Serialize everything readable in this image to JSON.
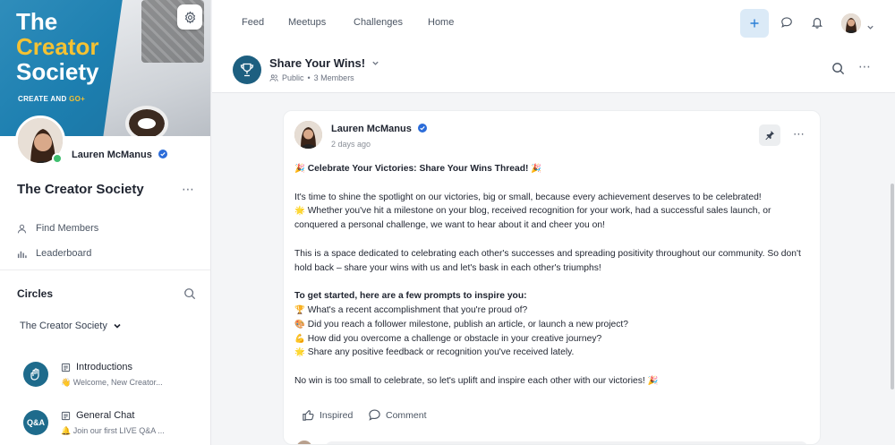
{
  "sidebar": {
    "banner": {
      "title_line1": "The",
      "title_line2": "Creator",
      "title_line3": "Society",
      "tagline_part1": "CREATE AND ",
      "tagline_part2": "GO+"
    },
    "profile_name": "Lauren McManus",
    "community_name": "The Creator Society",
    "more_glyph": "⋯",
    "links": [
      {
        "label": "Find Members",
        "icon": "person-icon"
      },
      {
        "label": "Leaderboard",
        "icon": "bar-chart-icon"
      }
    ],
    "circles_title": "Circles",
    "circle_dropdown": "The Creator Society",
    "spaces": [
      {
        "title": "Introductions",
        "subtitle": "👋 Welcome, New Creator...",
        "icon": "wave-hand-icon"
      },
      {
        "title": "General Chat",
        "subtitle": "🔔 Join our first LIVE Q&A ...",
        "icon_text": "Q&A"
      }
    ]
  },
  "topnav": {
    "links": [
      "Feed",
      "Meetups",
      "Challenges",
      "Home"
    ],
    "icons": [
      "plus-icon",
      "chat-bubble-icon",
      "bell-icon",
      "avatar",
      "chevron-down-icon"
    ]
  },
  "space_header": {
    "title": "Share Your Wins!",
    "visibility": "Public",
    "separator": "•",
    "members": "3 Members",
    "more_glyph": "⋯"
  },
  "post": {
    "author": "Lauren McManus",
    "time": "2 days ago",
    "more_glyph": "⋯",
    "heading_emoji": "🎉",
    "heading": "Celebrate Your Victories: Share Your Wins Thread!",
    "para1": "It's time to shine the spotlight on our victories, big or small, because every achievement deserves to be celebrated!",
    "para1_emoji": "🌟",
    "para1b": "Whether you've hit a milestone on your blog, received recognition for your work, had a successful sales launch, or conquered a personal challenge, we want to hear about it and cheer you on!",
    "para2": "This is a space dedicated to celebrating each other's successes and spreading positivity throughout our community. So don't hold back – share your wins with us and let's bask in each other's triumphs!",
    "prompts_heading": "To get started, here are a few prompts to inspire you:",
    "prompts": [
      {
        "emoji": "🏆",
        "text": "What's a recent accomplishment that you're proud of?"
      },
      {
        "emoji": "🎨",
        "text": "Did you reach a follower milestone, publish an article, or launch a new project?"
      },
      {
        "emoji": "💪",
        "text": "How did you overcome a challenge or obstacle in your creative journey?"
      },
      {
        "emoji": "🌟",
        "text": "Share any positive feedback or recognition you've received lately."
      }
    ],
    "closing": "No win is too small to celebrate, so let's uplift and inspire each other with our victories!",
    "closing_emoji": "🎉",
    "actions": {
      "like": "Inspired",
      "comment": "Comment"
    }
  },
  "colors": {
    "accent": "#f5c233",
    "brand_blue": "#1d7fb0",
    "online": "#3fbf6f",
    "verified": "#2b6cd9"
  }
}
